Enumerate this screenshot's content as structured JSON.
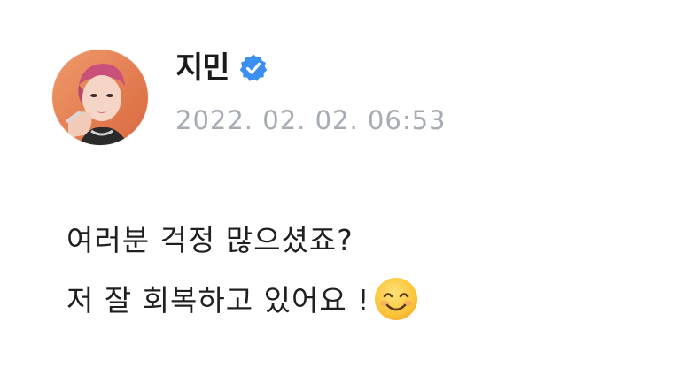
{
  "post": {
    "author": {
      "name": "지민",
      "verified_icon": "verified-badge-icon",
      "avatar": "profile-photo",
      "avatar_bg": "#e8875a"
    },
    "timestamp": "2022. 02. 02. 06:53",
    "body_lines": [
      "여러분 걱정 많으셨죠?",
      "저 잘 회복하고 있어요 !"
    ],
    "emoji": "smiling-face-icon"
  },
  "colors": {
    "verified": "#3a8ff0",
    "timestamp": "#a6acb4",
    "text": "#1f1f1f"
  }
}
